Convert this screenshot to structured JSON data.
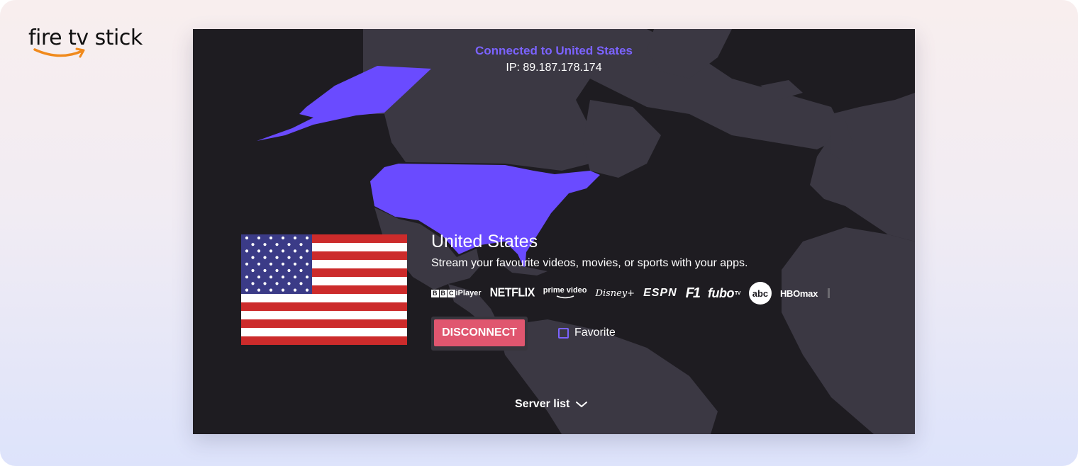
{
  "logo": {
    "brand": "fire",
    "tv": "tv",
    "stick": "stick"
  },
  "status": {
    "connected_text": "Connected to United States",
    "ip_text": "IP: 89.187.178.174"
  },
  "location": {
    "country": "United States",
    "tagline": "Stream your favourite videos, movies, or sports with your apps."
  },
  "apps": {
    "bbc_letters": [
      "B",
      "B",
      "C"
    ],
    "bbc_suffix": "iPlayer",
    "netflix": "NETFLIX",
    "prime": "prime video",
    "disney": "Disney+",
    "espn": "ESPN",
    "f1": "F1",
    "fubo": "fubo",
    "fubo_sup": "TV",
    "abc": "abc",
    "hbomax": "HBOmax"
  },
  "actions": {
    "disconnect": "DISCONNECT",
    "favorite": "Favorite",
    "favorite_checked": false,
    "server_list": "Server list"
  },
  "colors": {
    "accent": "#7b63ff",
    "highlight_country": "#6a4bff",
    "land": "#3a3742",
    "ocean": "#1e1c21",
    "disconnect": "#e0566f"
  },
  "icons": {
    "logo_swoosh": "smile-arrow-icon",
    "server_chevron": "chevron-down-icon",
    "prime_smile": "prime-smile-icon"
  }
}
